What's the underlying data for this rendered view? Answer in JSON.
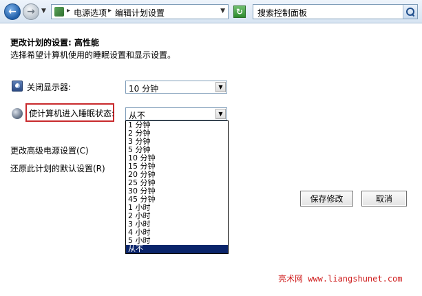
{
  "address_bar": {
    "breadcrumb": [
      "电源选项",
      "编辑计划设置"
    ],
    "search_placeholder": "搜索控制面板"
  },
  "page": {
    "title": "更改计划的设置: 高性能",
    "subtitle": "选择希望计算机使用的睡眠设置和显示设置。"
  },
  "settings": {
    "display_off": {
      "label": "关闭显示器:",
      "value": "10 分钟"
    },
    "sleep": {
      "label": "使计算机进入睡眠状态:",
      "value": "从不",
      "options": [
        "1 分钟",
        "2 分钟",
        "3 分钟",
        "5 分钟",
        "10 分钟",
        "15 分钟",
        "20 分钟",
        "25 分钟",
        "30 分钟",
        "45 分钟",
        "1 小时",
        "2 小时",
        "3 小时",
        "4 小时",
        "5 小时",
        "从不"
      ],
      "selected_option": "从不"
    }
  },
  "links": {
    "advanced": "更改高级电源设置(C)",
    "restore": "还原此计划的默认设置(R)"
  },
  "buttons": {
    "save": "保存修改",
    "cancel": "取消"
  },
  "watermark": "亮术网 www.liangshunet.com",
  "colors": {
    "highlight_box": "#c8292c",
    "selected_option": "#0a246a",
    "watermark": "#d02020"
  }
}
